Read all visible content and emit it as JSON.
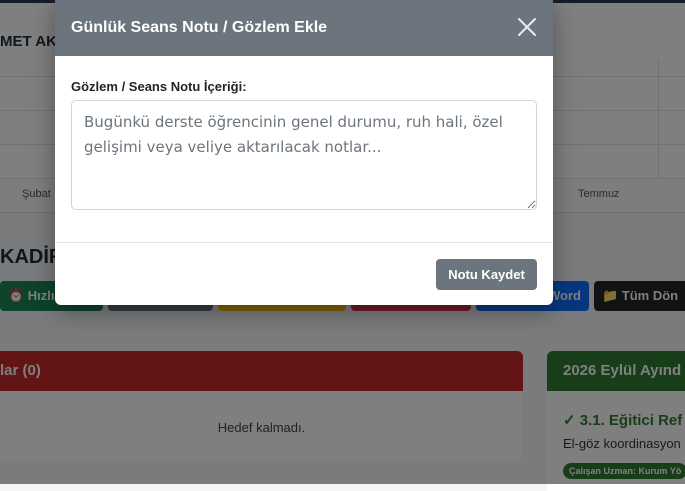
{
  "background": {
    "header_title": "MET AK",
    "months": [
      "Şubat",
      "Temmuz"
    ],
    "section_title": "KADİR",
    "buttons": [
      {
        "label": "⏰ Hızlı",
        "color": "#198754"
      },
      {
        "label": "",
        "color": "#6c757d"
      },
      {
        "label": "",
        "color": "#ffc107"
      },
      {
        "label": "",
        "color": "#dc3545"
      },
      {
        "label": "Word",
        "color": "#0d6efd"
      },
      {
        "label": "📁 Tüm Dön",
        "color": "#212529"
      }
    ],
    "red_card": {
      "title": "lar (0)",
      "empty_text": "Hedef kalmadı."
    },
    "green_card": {
      "title": "2026 Eylül Ayınd",
      "goal_title": "✓ 3.1. Eğitici Ref",
      "goal_desc": "El-göz koordinasyon",
      "badge": "Çalışan Uzman: Kurum Yö"
    }
  },
  "modal": {
    "title": "Günlük Seans Notu / Gözlem Ekle",
    "close_icon": "close-icon",
    "label": "Gözlem / Seans Notu İçeriği:",
    "textarea_placeholder": "Bugünkü derste öğrencinin genel durumu, ruh hali, özel gelişimi veya veliye aktarılacak notlar...",
    "save_label": "Notu Kaydet"
  }
}
